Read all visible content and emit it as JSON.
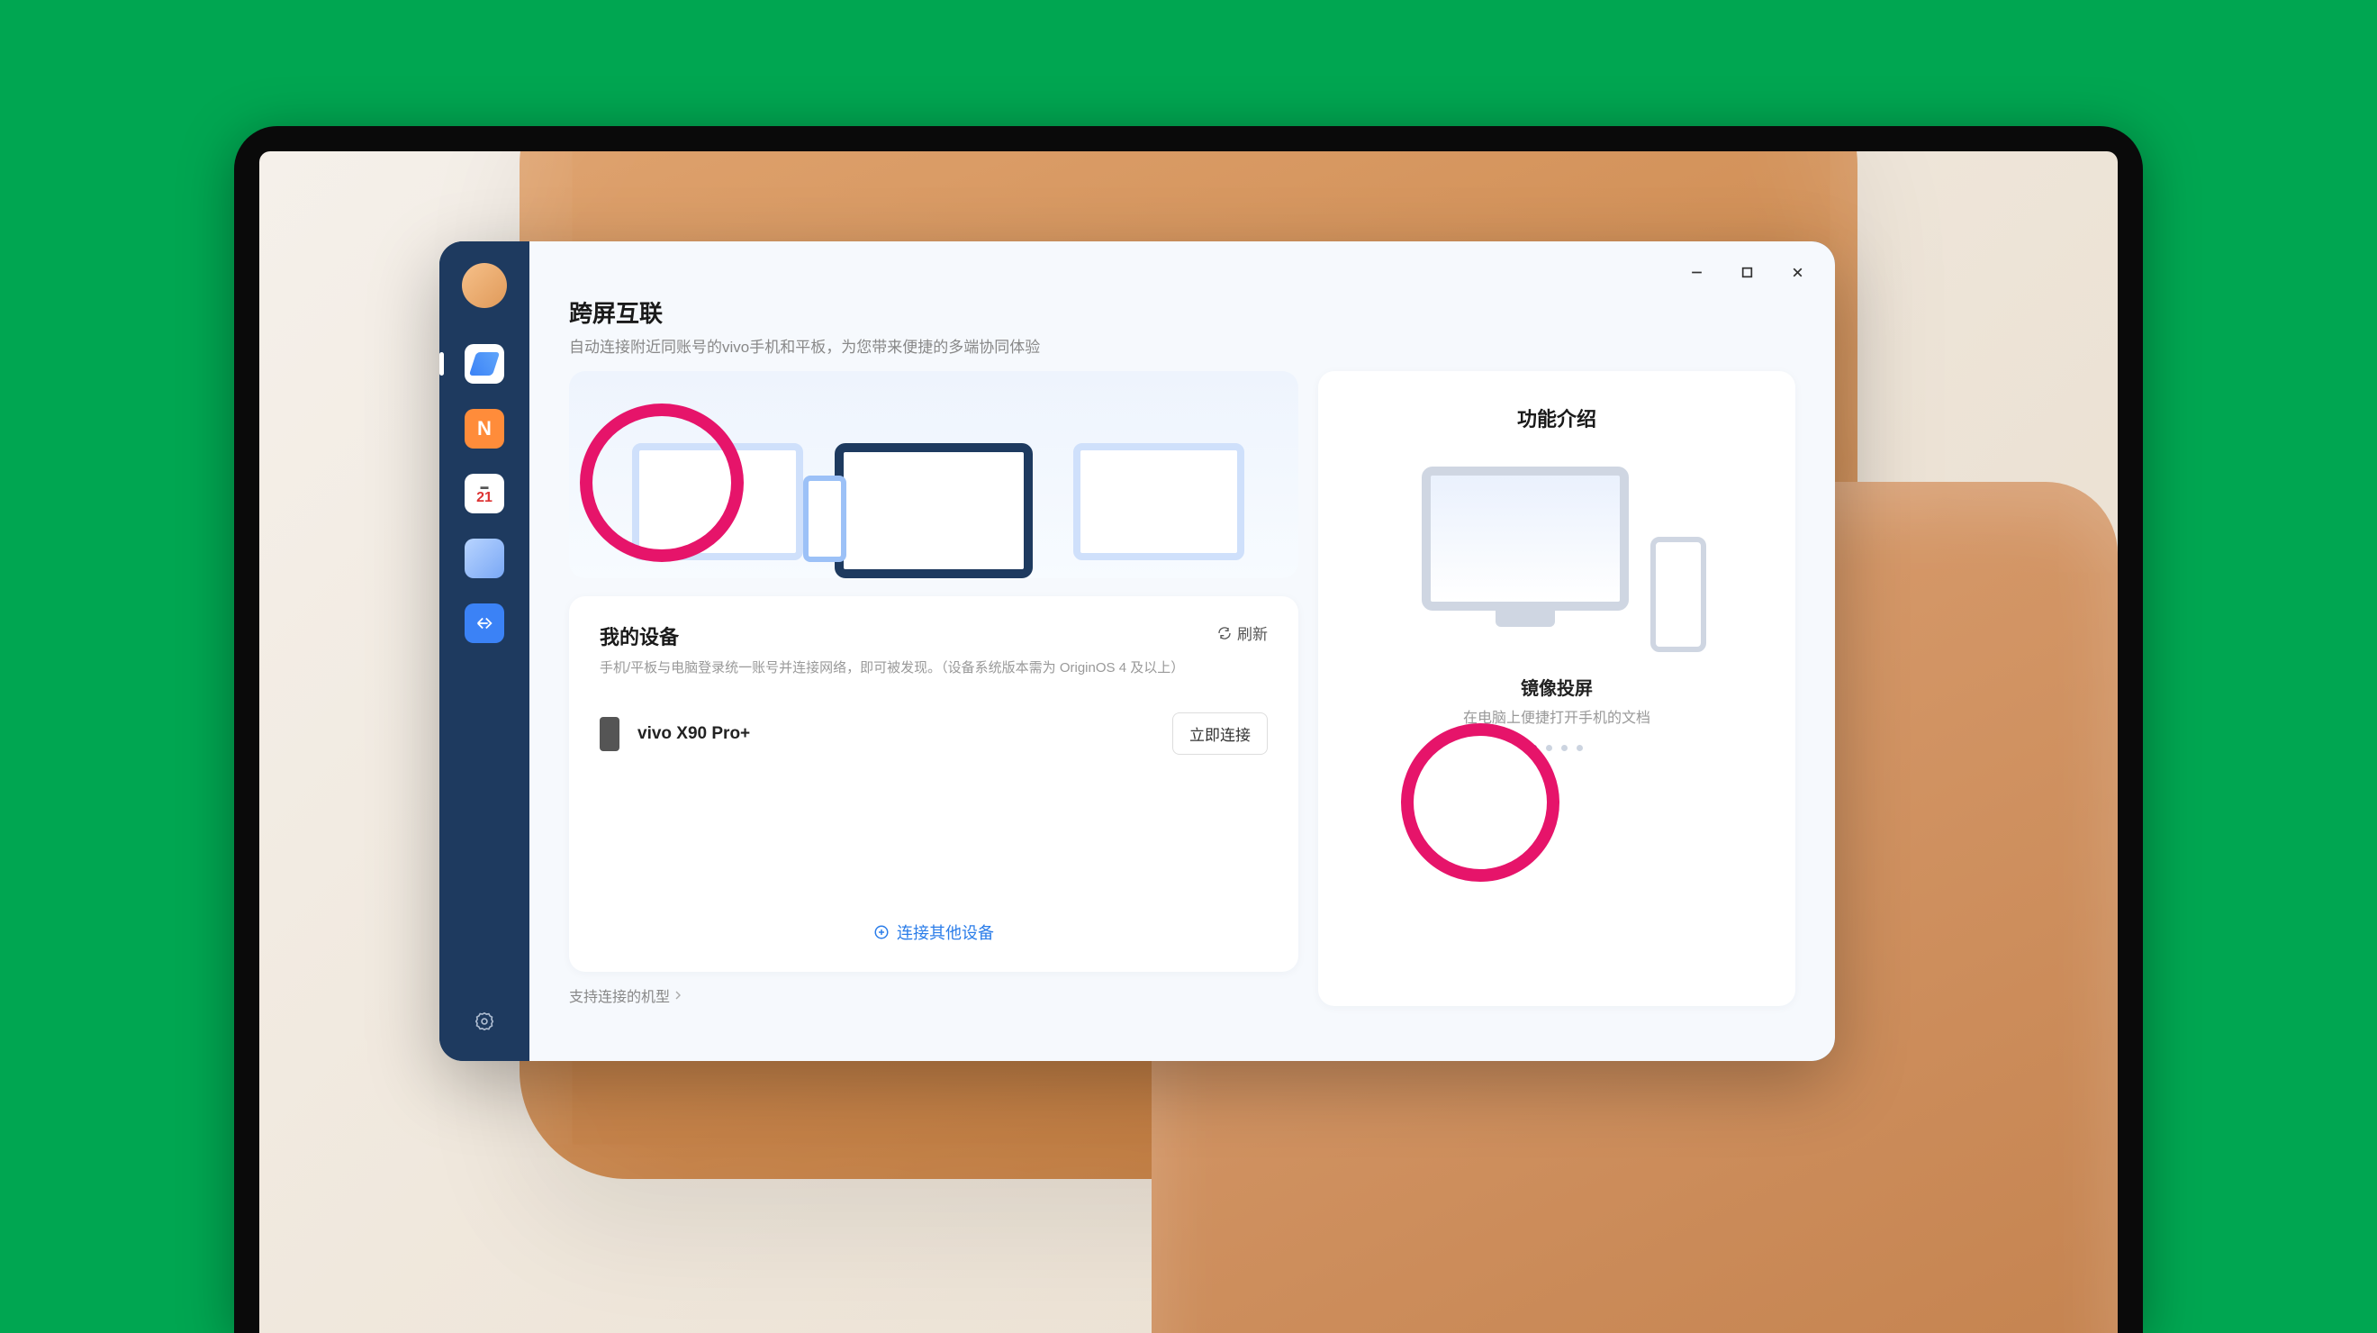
{
  "header": {
    "title": "跨屏互联",
    "subtitle": "自动连接附近同账号的vivo手机和平板，为您带来便捷的多端协同体验"
  },
  "sidebar": {
    "calendar_number": "21"
  },
  "devices_panel": {
    "title": "我的设备",
    "subtitle": "手机/平板与电脑登录统一账号并连接网络，即可被发现。（设备系统版本需为 OriginOS 4 及以上）",
    "refresh_label": "刷新",
    "items": [
      {
        "name": "vivo X90 Pro+",
        "action_label": "立即连接"
      }
    ],
    "other_link": "连接其他设备"
  },
  "feature_panel": {
    "section_title": "功能介绍",
    "feature_name": "镜像投屏",
    "feature_desc": "在电脑上便捷打开手机的文档",
    "dot_count": 4,
    "active_dot": 0
  },
  "footer": {
    "supported_models": "支持连接的机型"
  }
}
